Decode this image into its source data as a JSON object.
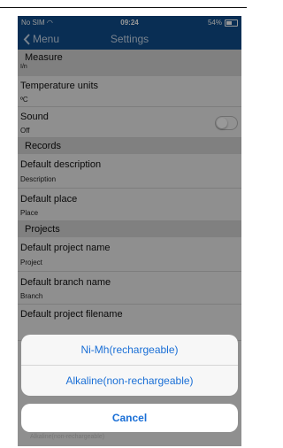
{
  "status": {
    "carrier": "No SIM",
    "time": "09:24",
    "battery": "54%"
  },
  "nav": {
    "back_label": "Menu",
    "title": "Settings"
  },
  "sections": {
    "measure": {
      "title": "Measure",
      "sub": "I/n"
    },
    "records": {
      "title": "Records"
    },
    "projects": {
      "title": "Projects"
    }
  },
  "rows": {
    "temperature": {
      "label": "Temperature units",
      "value": "ºC"
    },
    "sound": {
      "label": "Sound",
      "value": "Off",
      "toggle_on": false
    },
    "default_description": {
      "label": "Default description",
      "value": "Description"
    },
    "default_place": {
      "label": "Default place",
      "value": "Place"
    },
    "default_project_name": {
      "label": "Default project name",
      "value": "Project"
    },
    "default_branch_name": {
      "label": "Default branch name",
      "value": "Branch"
    },
    "default_project_filename": {
      "label": "Default project filename"
    }
  },
  "action_sheet": {
    "options": [
      "Ni-Mh(rechargeable)",
      "Alkaline(non-rechargeable)"
    ],
    "cancel": "Cancel",
    "peek_text": "Alkaline(non-rechargeable)"
  },
  "colors": {
    "navbar": "#0f4e8c",
    "accent": "#1a6fd6",
    "section": "#d6d6d6"
  }
}
